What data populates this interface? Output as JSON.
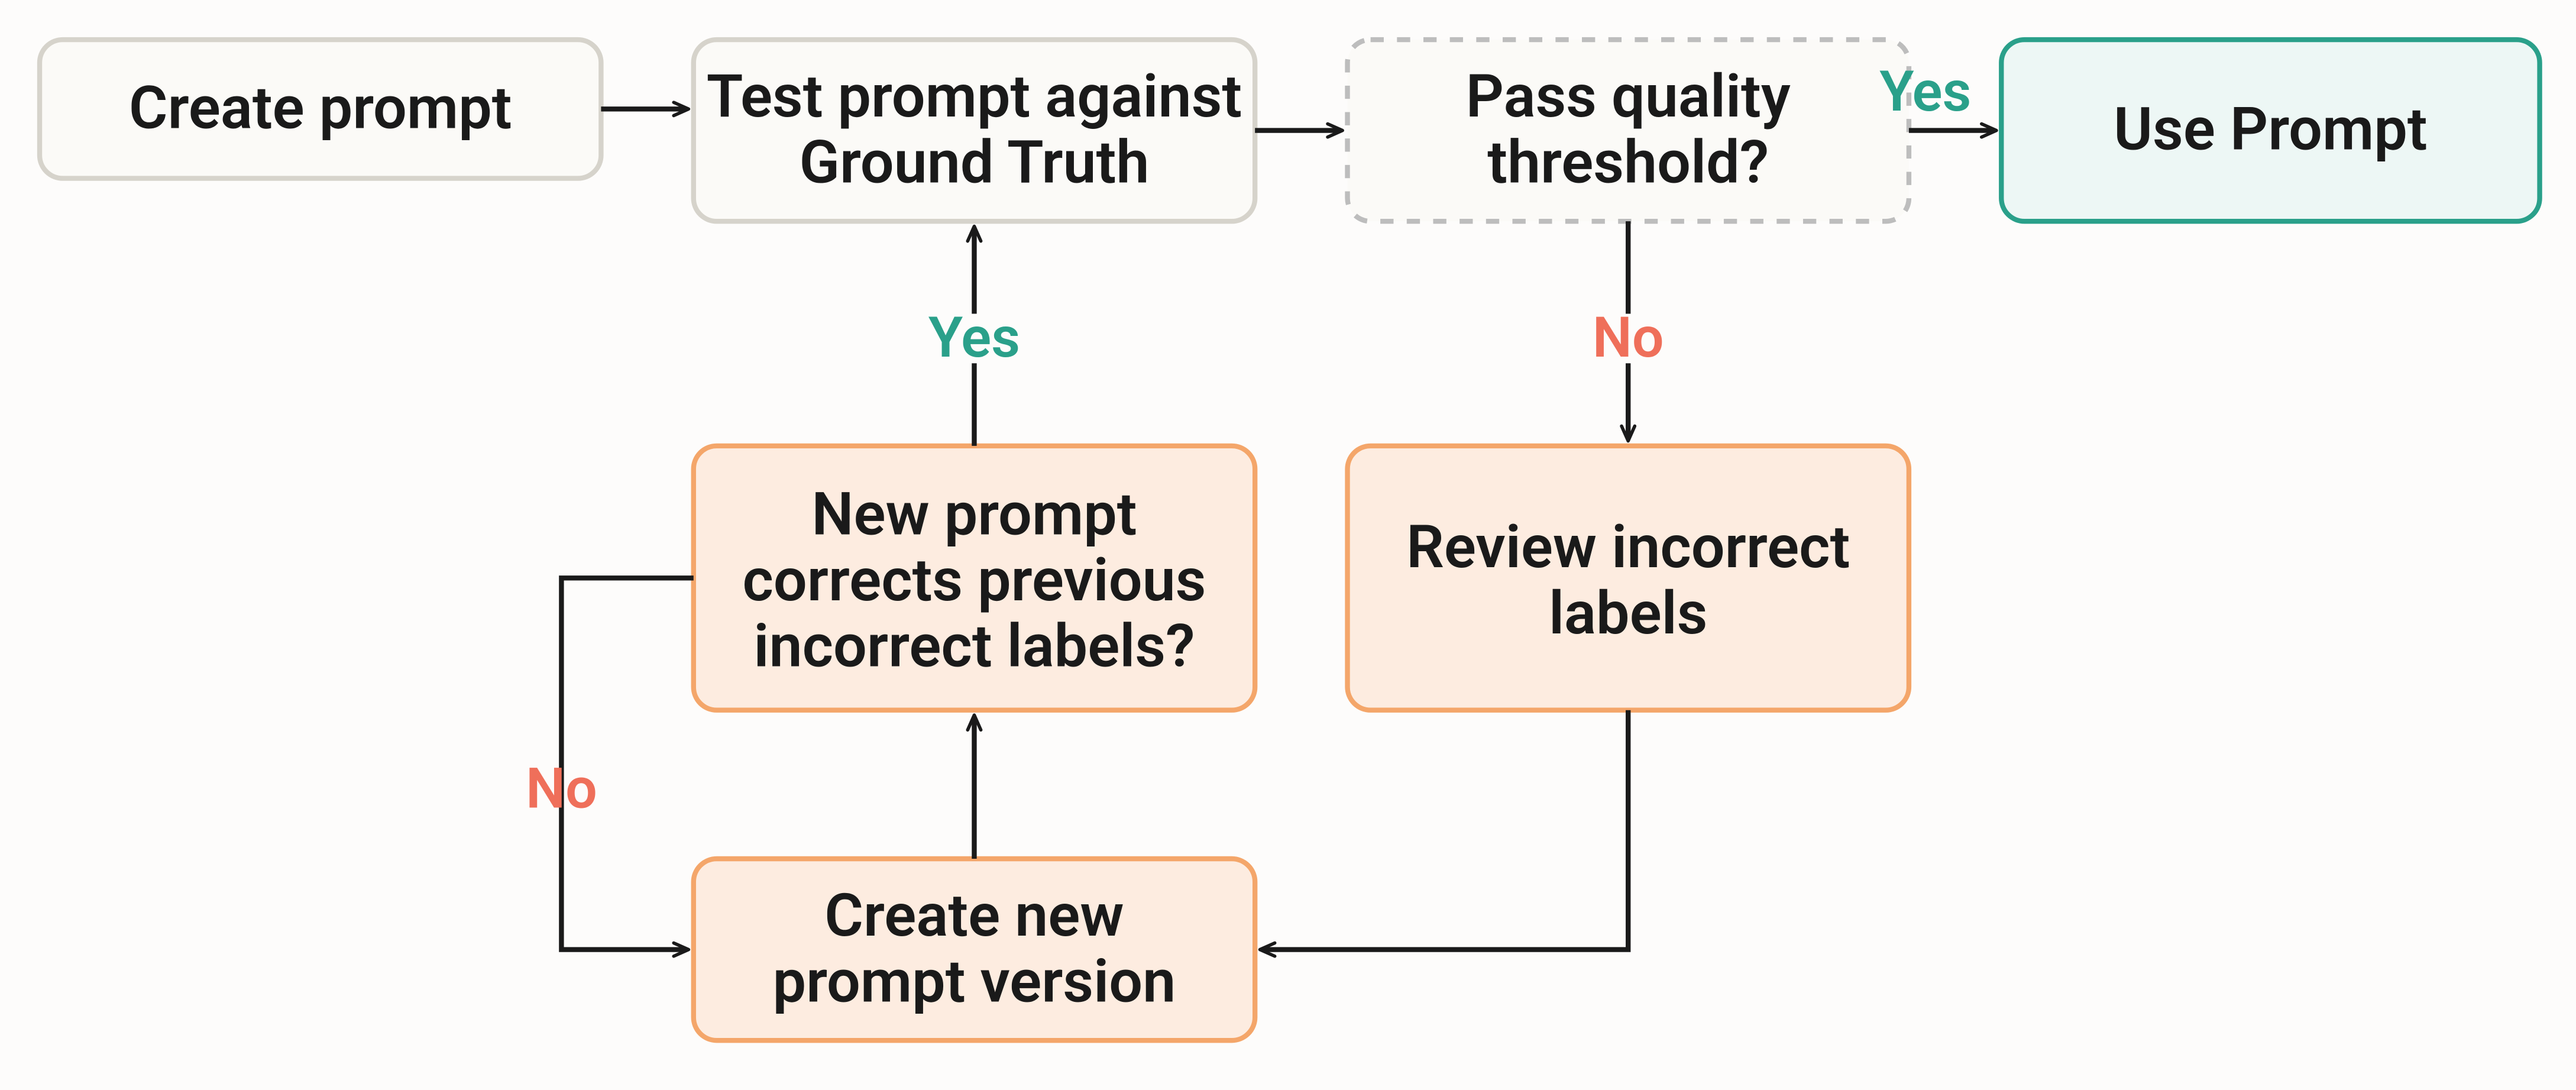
{
  "diagram": {
    "type": "flowchart",
    "title": "Prompt iteration workflow",
    "nodes": {
      "create_prompt": {
        "label": "Create prompt",
        "style": "neutral"
      },
      "test_prompt_l1": {
        "label": "Test prompt against",
        "style": "neutral"
      },
      "test_prompt_l2": {
        "label": "Ground Truth",
        "style": "neutral"
      },
      "pass_quality_l1": {
        "label": "Pass quality",
        "style": "decision_dashed"
      },
      "pass_quality_l2": {
        "label": "threshold?",
        "style": "decision_dashed"
      },
      "use_prompt": {
        "label": "Use Prompt",
        "style": "success"
      },
      "review_l1": {
        "label": "Review incorrect",
        "style": "warn"
      },
      "review_l2": {
        "label": "labels",
        "style": "warn"
      },
      "create_new_l1": {
        "label": "Create new",
        "style": "warn"
      },
      "create_new_l2": {
        "label": "prompt version",
        "style": "warn"
      },
      "new_corrects_l1": {
        "label": "New prompt",
        "style": "warn"
      },
      "new_corrects_l2": {
        "label": "corrects previous",
        "style": "warn"
      },
      "new_corrects_l3": {
        "label": "incorrect labels?",
        "style": "warn"
      }
    },
    "edges": {
      "yes_to_use": {
        "label": "Yes",
        "color": "yes"
      },
      "no_to_review": {
        "label": "No",
        "color": "no"
      },
      "yes_to_test": {
        "label": "Yes",
        "color": "yes"
      },
      "no_to_create": {
        "label": "No",
        "color": "no"
      }
    },
    "colors": {
      "neutral_border": "#d6d3cb",
      "neutral_fill": "#fbfaf7",
      "warn_border": "#f4a66a",
      "warn_fill": "#fdece0",
      "success_border": "#2aa08a",
      "success_fill": "#edf7f5",
      "dashed_border": "#bdbdbd",
      "dashed_fill": "#fbfaf7",
      "arrow": "#1a1a1a",
      "yes": "#2aa08a",
      "no": "#ef6f5a"
    }
  }
}
